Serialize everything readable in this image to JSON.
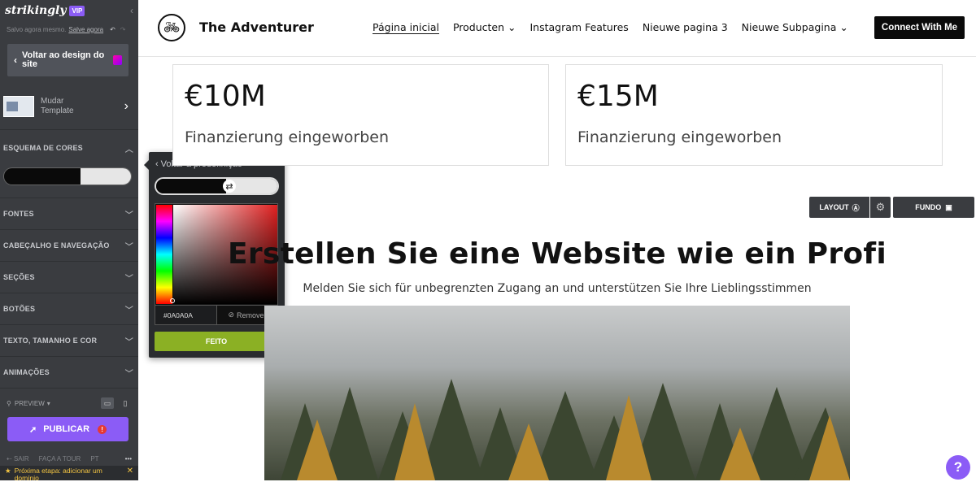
{
  "sidebar": {
    "logo": "strikingly",
    "vip_badge": "VIP",
    "saved_text": "Salvo agora mesmo.",
    "saved_link": "Salve agora",
    "back_design": "Voltar ao design do site",
    "template_label": "Mudar Template",
    "sections": [
      {
        "label": "ESQUEMA DE CORES",
        "expanded": true
      },
      {
        "label": "FONTES"
      },
      {
        "label": "CABEÇALHO E NAVEGAÇÃO"
      },
      {
        "label": "SEÇÕES"
      },
      {
        "label": "BOTÕES"
      },
      {
        "label": "TEXTO, TAMANHO E COR"
      },
      {
        "label": "ANIMAÇÕES"
      }
    ],
    "preview_label": "PREVIEW",
    "publish_label": "PUBLICAR",
    "bottom_links": [
      "SAIR",
      "FAÇA A TOUR",
      "PT"
    ],
    "next_step": "Próxima etapa: adicionar um domínio"
  },
  "popover": {
    "back_label": "Voltar à predefinição",
    "hex_value": "#0A0A0A",
    "remove_label": "Remover",
    "done_label": "FEITO"
  },
  "site": {
    "brand": "The Adventurer",
    "menu": [
      "Página inicial",
      "Producten",
      "Instagram Features",
      "Nieuwe pagina 3",
      "Nieuwe Subpagina"
    ],
    "cta": "Connect With Me",
    "stats": [
      {
        "value": "€10M",
        "label": "Finanzierung eingeworben"
      },
      {
        "value": "€15M",
        "label": "Finanzierung eingeworben"
      }
    ],
    "layout_btn": "LAYOUT",
    "fundo_btn": "FUNDO",
    "hero_title": "Erstellen Sie eine Website wie ein Profi",
    "hero_sub": "Melden Sie sich für unbegrenzten Zugang an und unterstützen Sie Ihre Lieblingsstimmen"
  },
  "colors": {
    "accent": "#8b5cf6",
    "done": "#8bb024",
    "sidebar": "#3a3c40"
  }
}
